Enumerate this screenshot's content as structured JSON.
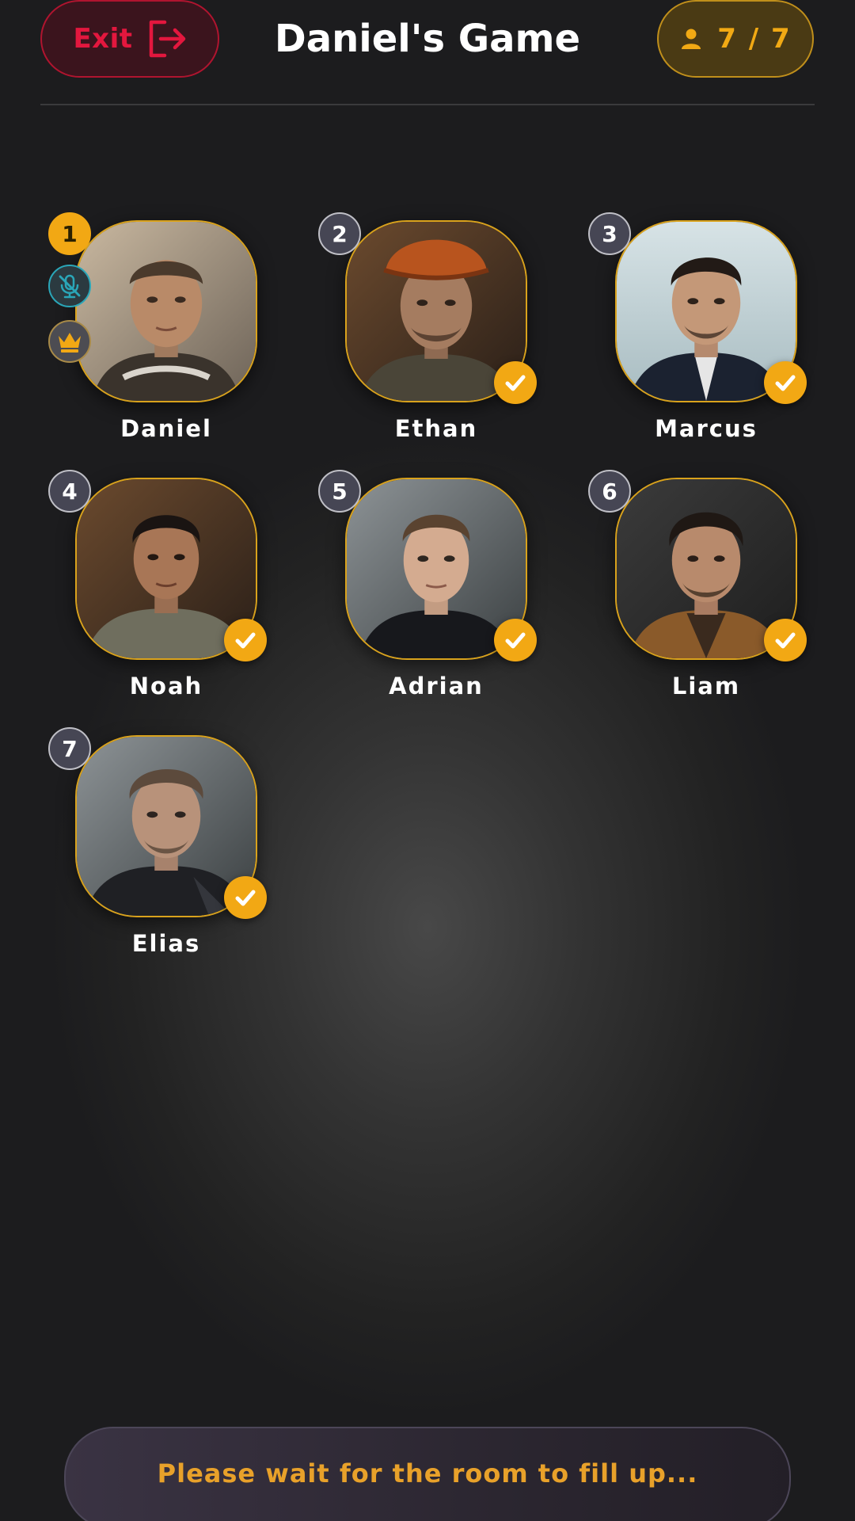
{
  "header": {
    "exit_label": "Exit",
    "title": "Daniel's Game",
    "player_count": "7 / 7"
  },
  "players": [
    {
      "number": "1",
      "name": "Daniel",
      "host": true,
      "muted": true,
      "ready": false
    },
    {
      "number": "2",
      "name": "Ethan",
      "host": false,
      "muted": false,
      "ready": true
    },
    {
      "number": "3",
      "name": "Marcus",
      "host": false,
      "muted": false,
      "ready": true
    },
    {
      "number": "4",
      "name": "Noah",
      "host": false,
      "muted": false,
      "ready": true
    },
    {
      "number": "5",
      "name": "Adrian",
      "host": false,
      "muted": false,
      "ready": true
    },
    {
      "number": "6",
      "name": "Liam",
      "host": false,
      "muted": false,
      "ready": true
    },
    {
      "number": "7",
      "name": "Elias",
      "host": false,
      "muted": false,
      "ready": true
    }
  ],
  "footer": {
    "status_text": "Please wait for the room to fill up..."
  },
  "colors": {
    "accent": "#f2a814",
    "exit": "#e3173e",
    "muted": "#2aa6b8",
    "background": "#1c1c1e"
  },
  "icons": {
    "exit": "exit-icon",
    "person": "person-icon",
    "mic_off": "mic-off-icon",
    "crown": "crown-icon",
    "check": "check-icon"
  }
}
